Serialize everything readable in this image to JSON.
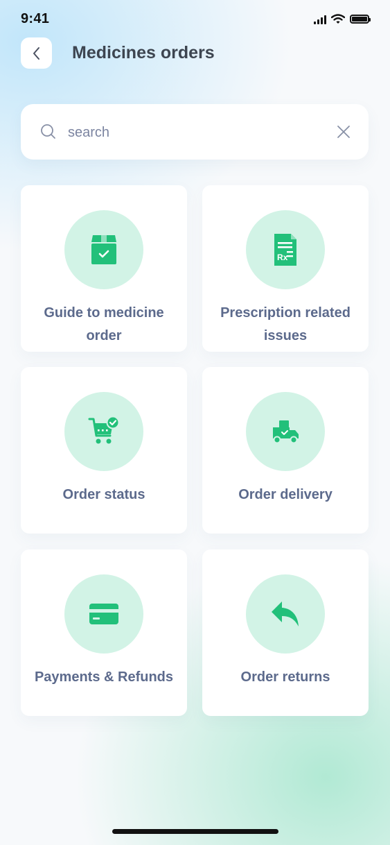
{
  "status_bar": {
    "time": "9:41"
  },
  "header": {
    "title": "Medicines orders",
    "back_icon": "chevron-left-icon"
  },
  "search": {
    "value": "",
    "placeholder": "search",
    "search_icon": "search-icon",
    "clear_icon": "close-icon"
  },
  "categories": [
    {
      "label": "Guide to medicine order",
      "icon": "package-check-icon"
    },
    {
      "label": "Prescription related issues",
      "icon": "prescription-icon"
    },
    {
      "label": "Order status",
      "icon": "cart-check-icon"
    },
    {
      "label": "Order delivery",
      "icon": "delivery-truck-icon"
    },
    {
      "label": "Payments & Refunds",
      "icon": "credit-card-icon"
    },
    {
      "label": "Order returns",
      "icon": "reply-arrow-icon"
    }
  ],
  "colors": {
    "accent": "#22c07a",
    "icon_bg": "#d2f3e6",
    "title": "#3d4550",
    "label": "#5c6a8c"
  }
}
